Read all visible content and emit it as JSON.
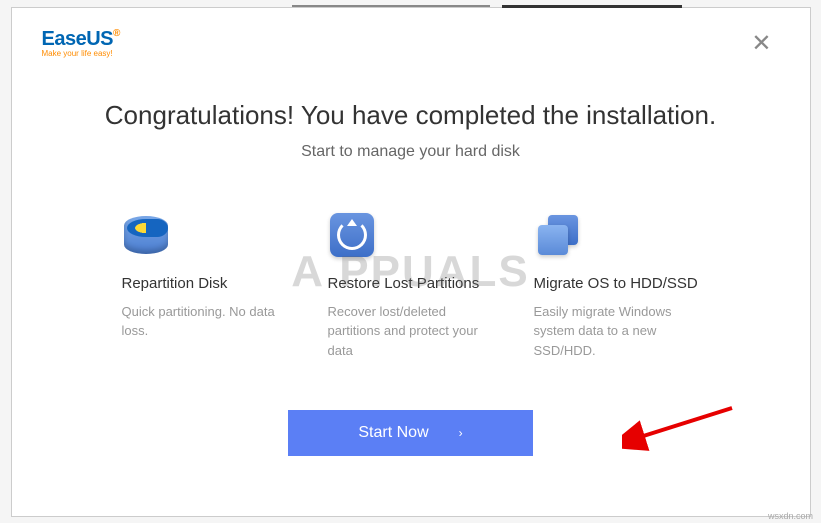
{
  "logo": {
    "brand": "EaseUS",
    "tagline": "Make your life easy!"
  },
  "title": "Congratulations! You have completed the installation.",
  "subtitle": "Start to manage your hard disk",
  "features": [
    {
      "title": "Repartition Disk",
      "description": "Quick partitioning. No data loss."
    },
    {
      "title": "Restore Lost Partitions",
      "description": "Recover lost/deleted partitions and protect your data"
    },
    {
      "title": "Migrate OS to HDD/SSD",
      "description": "Easily migrate Windows system data to a new SSD/HDD."
    }
  ],
  "cta": {
    "label": "Start Now"
  },
  "watermark": "A PPUALS",
  "attribution": "wsxdn.com"
}
